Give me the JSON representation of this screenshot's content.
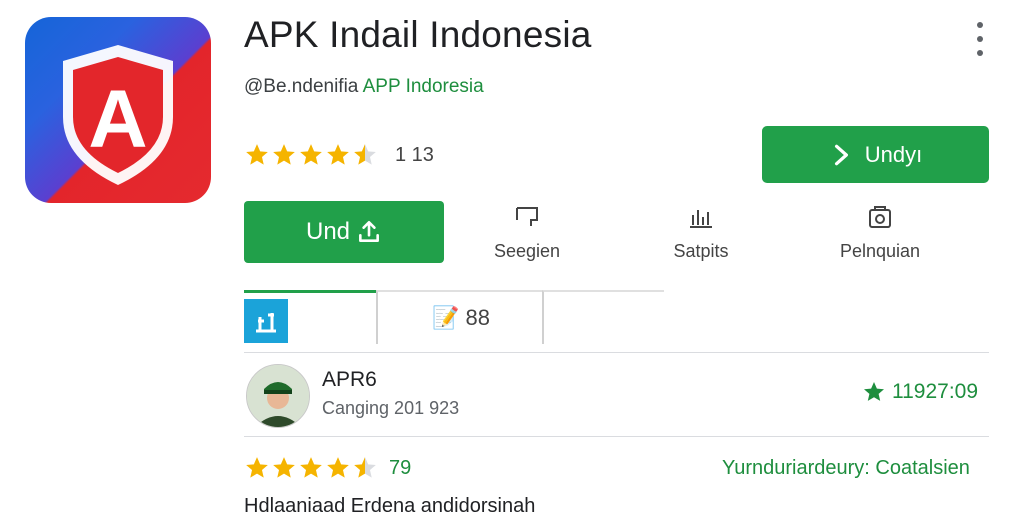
{
  "app": {
    "title": "APK Indail Indonesia",
    "developer_prefix": "@Be.ndenifia",
    "developer_name": "APP Indoresia",
    "rating_stars": 4.5,
    "rating_count": "1 13",
    "install_label": "Undyı",
    "download_label": "Und",
    "icon_letter": "A"
  },
  "actions": [
    {
      "label": "Seegien",
      "icon": "share-icon"
    },
    {
      "label": "Satpits",
      "icon": "stats-icon"
    },
    {
      "label": "Pelnquian",
      "icon": "camera-icon"
    }
  ],
  "tabs": {
    "second_label": "📝 88"
  },
  "review": {
    "name": "APR6",
    "date": "Canging 201 923",
    "score": "11927:09"
  },
  "second_rating": {
    "stars": 4.5,
    "count": "79"
  },
  "category": "Yurnduriardeury: Coatalsien",
  "description": "Hdlaaniaad Erdena andidorsinah",
  "colors": {
    "accent_green": "#21a04a",
    "star_yellow": "#f5b400"
  }
}
